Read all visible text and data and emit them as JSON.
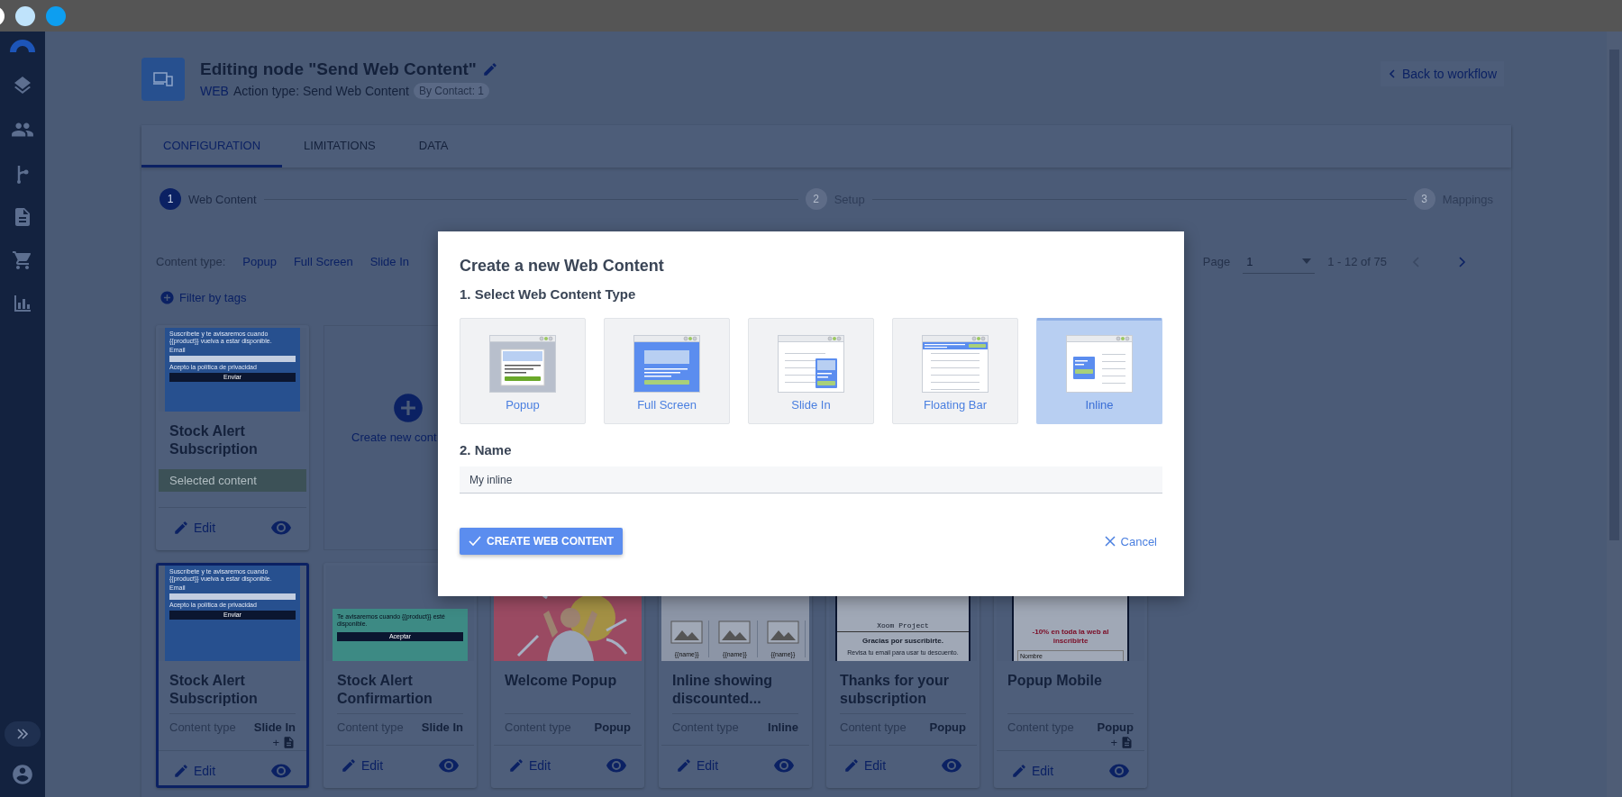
{
  "header": {
    "title": "Editing node \"Send Web Content\"",
    "channel": "WEB",
    "action_type": "Action type: Send Web Content",
    "badge": "By Contact: 1",
    "back_link": "Back to workflow"
  },
  "tabs": [
    {
      "label": "CONFIGURATION",
      "selected": true
    },
    {
      "label": "LIMITATIONS",
      "selected": false
    },
    {
      "label": "DATA",
      "selected": false
    }
  ],
  "steps": [
    {
      "number": "1",
      "label": "Web Content",
      "active": true
    },
    {
      "number": "2",
      "label": "Setup",
      "active": false
    },
    {
      "number": "3",
      "label": "Mappings",
      "active": false
    }
  ],
  "filters": {
    "label": "Content type:",
    "types": [
      "Popup",
      "Full Screen",
      "Slide In"
    ],
    "filter_tags": "Filter by tags"
  },
  "pagination": {
    "label": "Page",
    "page": "1",
    "range": "1 - 12 of 75"
  },
  "card_rows": [
    [
      {
        "kind": "content",
        "title": "Stock Alert Subscription",
        "selected": false,
        "status": "Selected content",
        "edit": "Edit",
        "thumb": {
          "kind": "form",
          "text": "Suscríbete y te avisaremos cuando {{product}} vuelva a estar disponible.",
          "field_label": "Email",
          "consent": "Acepto la política de privacidad",
          "button": "Enviar"
        }
      },
      {
        "kind": "create",
        "label": "Create new cont"
      }
    ],
    [
      {
        "kind": "content",
        "title": "Stock Alert Subscription",
        "selected": true,
        "meta_label": "Content type",
        "meta_value": "Slide In",
        "extra": "+",
        "edit": "Edit",
        "thumb": {
          "kind": "form",
          "text": "Suscríbete y te avisaremos cuando {{product}} vuelva a estar disponible.",
          "field_label": "Email",
          "consent": "Acepto la política de privacidad",
          "button": "Enviar"
        }
      },
      {
        "kind": "content",
        "title": "Stock Alert Confirmartion",
        "selected": false,
        "meta_label": "Content type",
        "meta_value": "Slide In",
        "edit": "Edit",
        "thumb": {
          "kind": "confirm",
          "text": "Te avisaremos cuando {{product}} esté disponible.",
          "button": "Aceptar"
        }
      },
      {
        "kind": "content",
        "title": "Welcome Popup",
        "selected": false,
        "meta_label": "Content type",
        "meta_value": "Popup",
        "edit": "Edit"
      },
      {
        "kind": "content",
        "title": "Inline showing discounted...",
        "selected": false,
        "meta_label": "Content type",
        "meta_value": "Inline",
        "edit": "Edit",
        "thumb": {
          "kind": "inline",
          "captions": [
            "{{name}}",
            "{{name}}",
            "{{name}}"
          ]
        }
      },
      {
        "kind": "content",
        "title": "Thanks for your subscription",
        "selected": false,
        "meta_label": "Content type",
        "meta_value": "Popup",
        "edit": "Edit",
        "thumb": {
          "kind": "thanks",
          "brand": "Xoom Project",
          "heading": "Gracias por suscribirte.",
          "text": "Revisa tu email para usar tu descuento."
        }
      },
      {
        "kind": "content",
        "title": "Popup Mobile",
        "selected": false,
        "meta_label": "Content type",
        "meta_value": "Popup",
        "extra": "+",
        "edit": "Edit",
        "thumb": {
          "kind": "mobile",
          "offer": "-10% en toda la web al inscribirte",
          "field_label": "Nombre"
        }
      }
    ]
  ],
  "modal": {
    "title": "Create a new Web Content",
    "step_1": "1. Select Web Content Type",
    "types": [
      {
        "label": "Popup",
        "kind": "popup",
        "selected": false
      },
      {
        "label": "Full Screen",
        "kind": "fullscreen",
        "selected": false
      },
      {
        "label": "Slide In",
        "kind": "slidein",
        "selected": false
      },
      {
        "label": "Floating Bar",
        "kind": "floatingbar",
        "selected": false
      },
      {
        "label": "Inline",
        "kind": "inline",
        "selected": true
      }
    ],
    "step_2": "2. Name",
    "name_value": "My inline",
    "submit": "CREATE WEB CONTENT",
    "cancel": "Cancel"
  }
}
